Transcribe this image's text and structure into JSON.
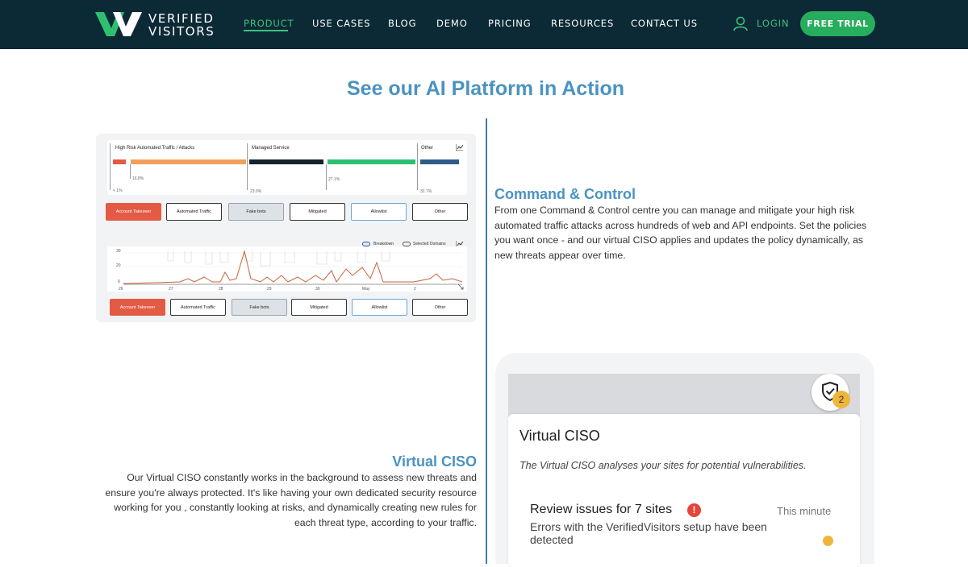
{
  "brand": {
    "line1": "VERIFIED",
    "line2": "VISITORS",
    "green": "#3ec27a",
    "navy": "#0c2a36"
  },
  "nav": {
    "items": [
      {
        "label": "PRODUCT",
        "active": true
      },
      {
        "label": "USE CASES"
      },
      {
        "label": "BLOG"
      },
      {
        "label": "DEMO"
      },
      {
        "label": "PRICING"
      },
      {
        "label": "RESOURCES"
      },
      {
        "label": "CONTACT US"
      }
    ],
    "login": "LOGIN",
    "login_icon": "user-icon",
    "trial": "FREE TRIAL"
  },
  "section_title": "See our AI Platform in Action",
  "dashboard": {
    "bar_labels": [
      "High Risk Automated Traffic / Attacks",
      "Managed Service",
      "Other"
    ],
    "percents": [
      "16.8%",
      "< 1%",
      "23.0%",
      "27.1%",
      "32.7%"
    ],
    "filters_top": [
      "Account Takeover",
      "Automated Traffic",
      "Fake bots",
      "Mitigated",
      "Allowlist",
      "Other"
    ],
    "toggles": [
      "Breakdown",
      "Selected Domains"
    ],
    "y_ticks": [
      "30",
      "20",
      "0"
    ],
    "x_ticks": [
      "26",
      "27",
      "28",
      "29",
      "30",
      "May",
      "2"
    ],
    "filters_bottom": [
      "Account Takeover",
      "Automated Traffic",
      "Fake bots",
      "Mitigated",
      "Allowlist",
      "Other"
    ]
  },
  "command": {
    "title": "Command & Control",
    "body": "From one Command & Control centre you can manage and mitigate your high risk automated traffic attacks across hundreds of web and API endpoints. Set the policies you want once - and our virtual CISO applies and updates the policy dynamically, as new threats appear over time."
  },
  "ciso": {
    "title": "Virtual CISO",
    "body": "Our Virtual CISO constantly works in the background to assess new threats and ensure you're always protected. It's like having your own dedicated security resource working for you , constantly looking at risks, and dynamically creating new rules for each threat type, according to your traffic."
  },
  "phone": {
    "badge": "2",
    "shield_icon": "shield-check-icon",
    "title": "Virtual CISO",
    "subtitle": "The Virtual CISO analyses your sites for potential vulnerabilities.",
    "review": "Review issues for 7 sites",
    "alert": "!",
    "time": "This minute",
    "errors": "Errors with the VerifiedVisitors setup have been detected"
  }
}
